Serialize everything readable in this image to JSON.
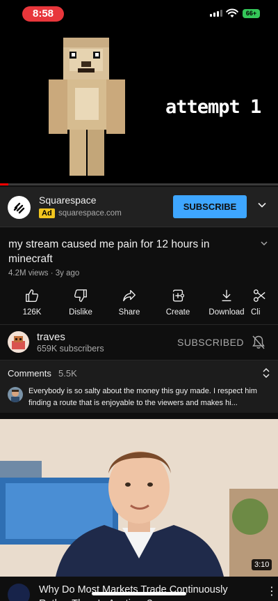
{
  "status_bar": {
    "time": "8:58",
    "battery": "66+"
  },
  "player": {
    "overlay_text": "attempt 1",
    "progress_percent": 3
  },
  "ad": {
    "advertiser": "Squarespace",
    "badge": "Ad",
    "url": "squarespace.com",
    "cta": "SUBSCRIBE",
    "logo_icon": "squarespace-logo-icon"
  },
  "video": {
    "title": "my stream caused me pain for 12 hours in minecraft",
    "meta": "4.2M views · 3y ago"
  },
  "actions": [
    {
      "label": "126K",
      "icon": "thumbs-up-icon"
    },
    {
      "label": "Dislike",
      "icon": "thumbs-down-icon"
    },
    {
      "label": "Share",
      "icon": "share-icon"
    },
    {
      "label": "Create",
      "icon": "create-icon"
    },
    {
      "label": "Download",
      "icon": "download-icon"
    },
    {
      "label": "Cli",
      "icon": "scissors-icon"
    }
  ],
  "channel": {
    "name": "traves",
    "subscribers": "659K subscribers",
    "subscribe_state": "SUBSCRIBED"
  },
  "comments": {
    "label": "Comments",
    "count": "5.5K",
    "top_comment": "Everybody is so salty about the money this guy made. I respect him finding a route that is enjoyable to the viewers and makes hi..."
  },
  "next_video": {
    "duration": "3:10",
    "title": "Why Do Most Markets Trade Continuously Rather Than In Auctions?"
  },
  "colors": {
    "background": "#0f0f0f",
    "accent_blue": "#3ea6ff",
    "progress_red": "#ff0000",
    "ad_badge_yellow": "#f2c61f"
  }
}
